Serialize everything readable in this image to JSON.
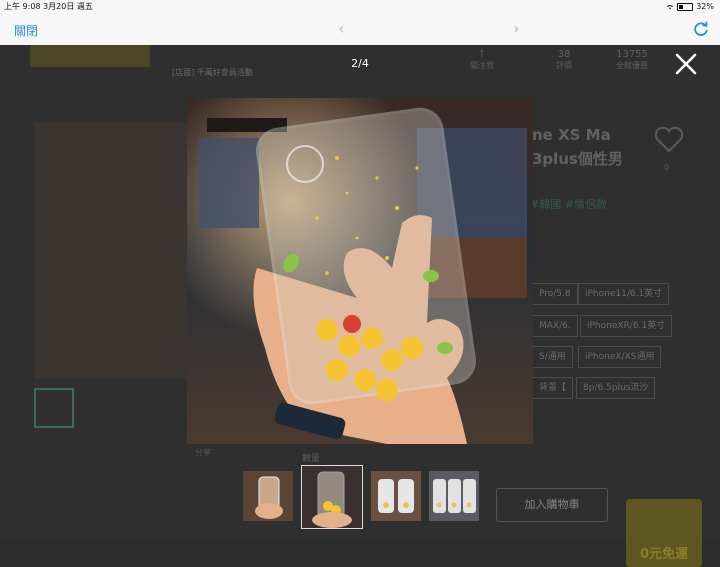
{
  "status_bar": {
    "time_date": "上午 9:08   3月20日 週五",
    "battery": "32%"
  },
  "browser": {
    "close_label": "關閉"
  },
  "background_page": {
    "promo": "[店面] 千萬好會員活動",
    "stats": [
      "↑",
      "38",
      "13755"
    ],
    "stat_labels": [
      "關注我",
      "評價",
      "全館優惠"
    ],
    "title_line1": "ne XS Ma",
    "title_line2": "3plus個性男",
    "tags": "#韓國  #情侶款",
    "options": [
      "Pro/5.8",
      "iPhone11/6.1英寸",
      "MAX/6.",
      "iPhoneXR/6.1英寸",
      "S/通用",
      "iPhoneX/XS通用",
      "背景【",
      "8p/6.5plus流沙"
    ],
    "share_label": "分享",
    "stock": "數量",
    "cart_button": "加入購物車",
    "ad_text": "0元免運"
  },
  "lightbox": {
    "counter": "2/4",
    "images": [
      {
        "name": "case-hand-orange"
      },
      {
        "name": "case-emoji-bar"
      },
      {
        "name": "case-white-pair"
      },
      {
        "name": "case-three-glitter"
      }
    ],
    "active_index": 1
  },
  "colors": {
    "accent": "#2a8cdc",
    "overlay": "#2c2c2c"
  }
}
